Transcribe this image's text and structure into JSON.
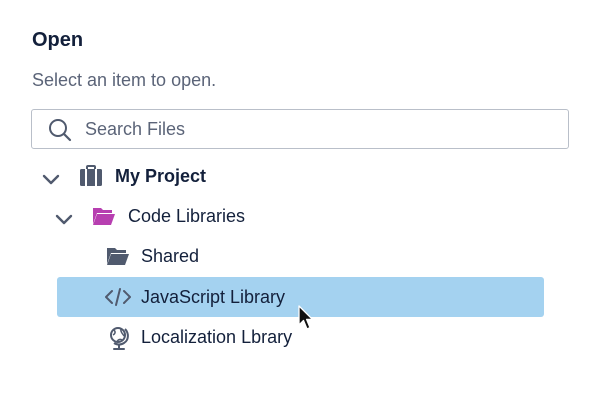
{
  "dialog": {
    "title": "Open",
    "subtitle": "Select an item to open."
  },
  "search": {
    "placeholder": "Search Files",
    "value": "",
    "icon": "search-icon"
  },
  "tree": {
    "items": [
      {
        "label": "My Project",
        "icon": "briefcase-icon",
        "expanded": true,
        "selected": false
      },
      {
        "label": "Code Libraries",
        "icon": "folder-open-icon",
        "expanded": true,
        "selected": false
      },
      {
        "label": "Shared",
        "icon": "folder-icon",
        "selected": false
      },
      {
        "label": "JavaScript Library",
        "icon": "code-icon",
        "selected": true
      },
      {
        "label": "Localization Lbrary",
        "icon": "globe-icon",
        "selected": false
      }
    ]
  },
  "colors": {
    "selection": "#a4d2f0",
    "folder_accent": "#b73fb0",
    "icon_gray": "#505a6e",
    "text": "#13203b"
  }
}
